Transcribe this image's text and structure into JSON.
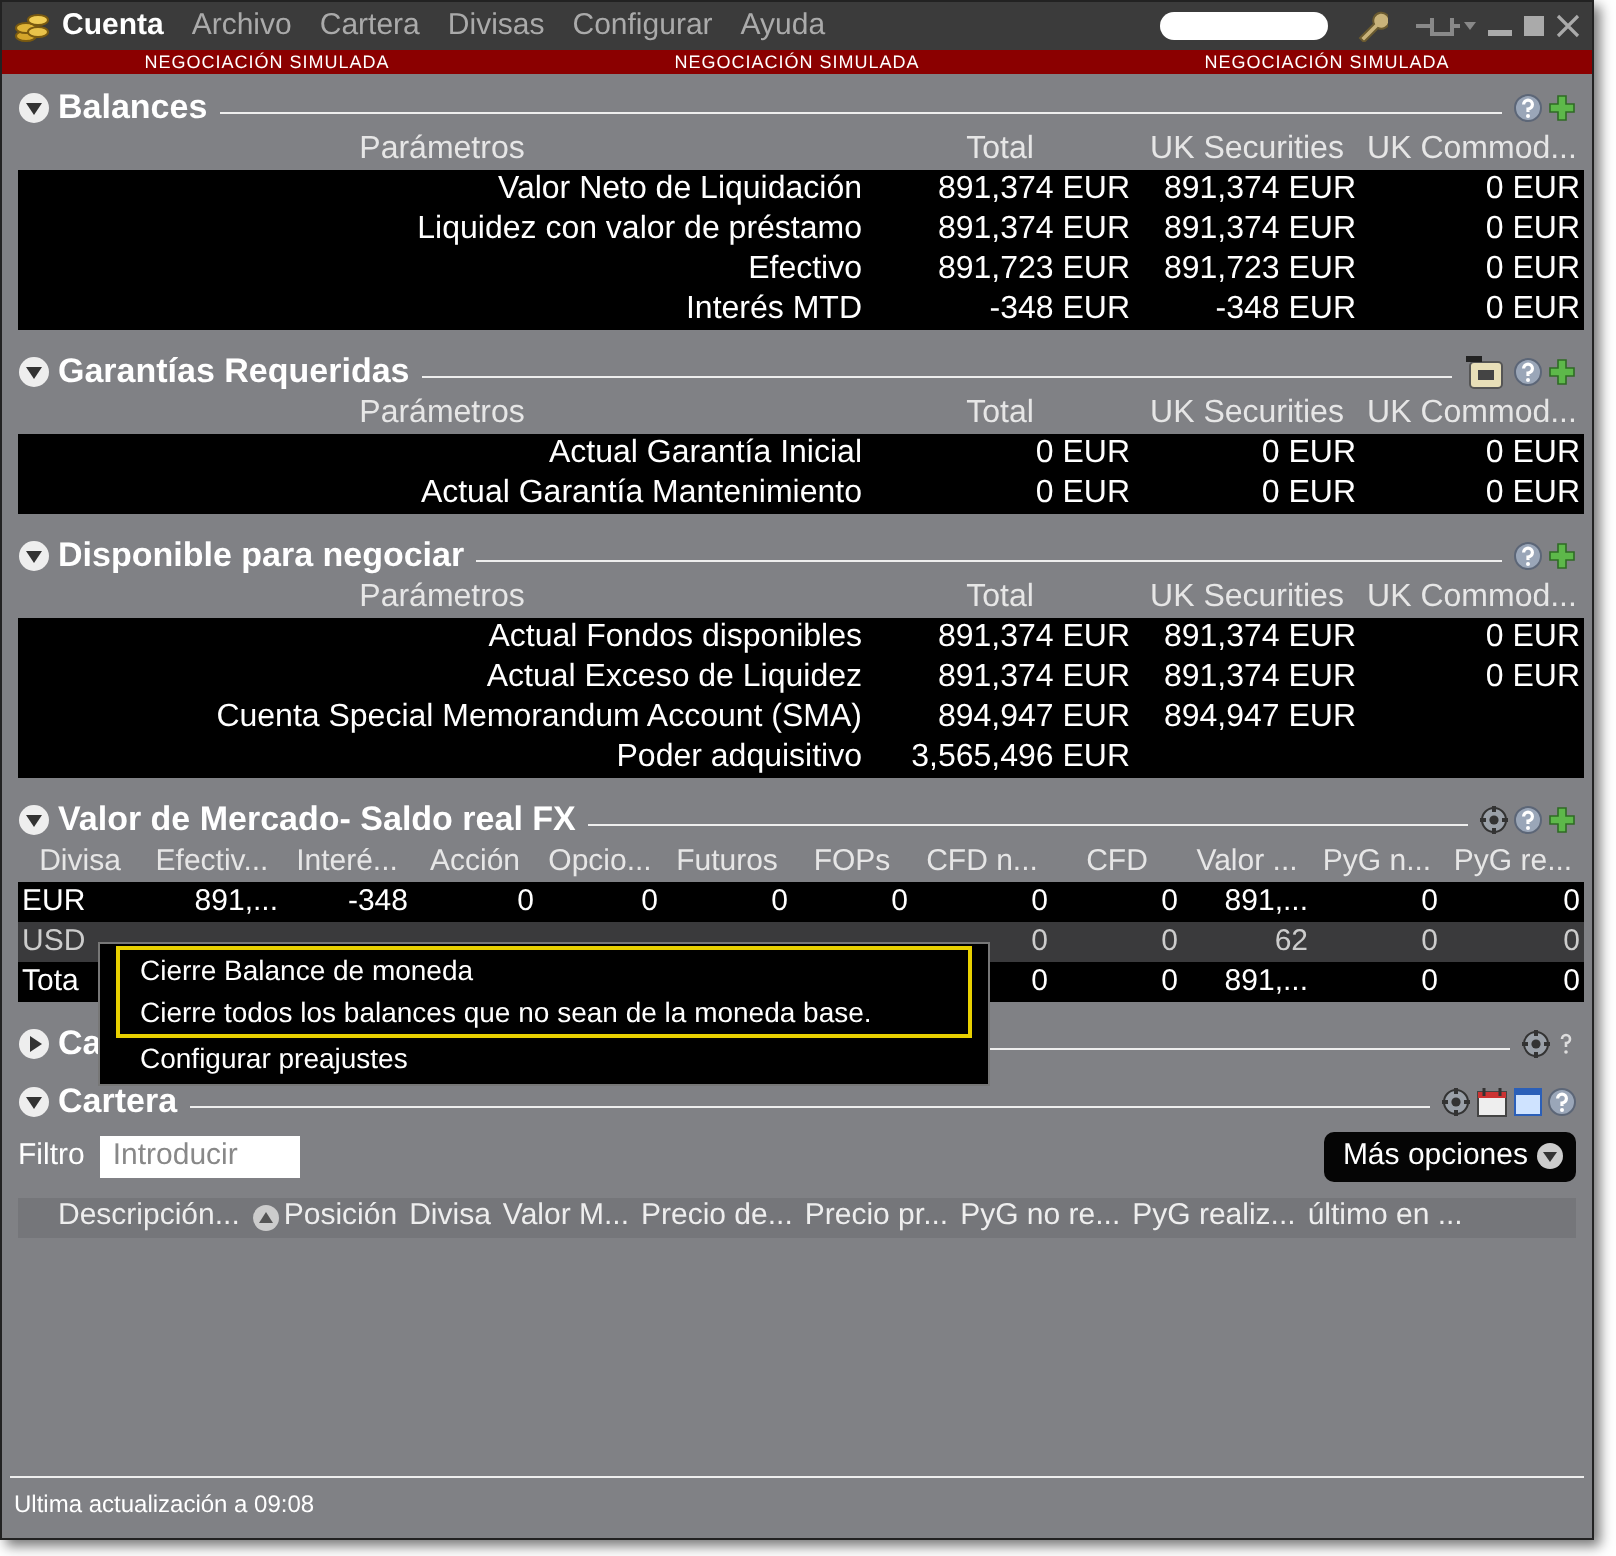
{
  "window": {
    "title": "Cuenta",
    "menu": [
      "Archivo",
      "Cartera",
      "Divisas",
      "Configurar",
      "Ayuda"
    ],
    "banner": [
      "NEGOCIACIÓN SIMULADA",
      "NEGOCIACIÓN SIMULADA",
      "NEGOCIACIÓN SIMULADA"
    ]
  },
  "sections": [
    {
      "kind": "grid",
      "title": "Balances",
      "expanded": true,
      "columns": [
        "Parámetros",
        "Total",
        "UK Securities",
        "UK Commod..."
      ],
      "rows": [
        [
          "Valor Neto de Liquidación",
          "891,374 EUR",
          "891,374 EUR",
          "0 EUR"
        ],
        [
          "Liquidez con valor de préstamo",
          "891,374 EUR",
          "891,374 EUR",
          "0 EUR"
        ],
        [
          "Efectivo",
          "891,723 EUR",
          "891,723 EUR",
          "0 EUR"
        ],
        [
          "Interés MTD",
          "-348 EUR",
          "-348 EUR",
          "0 EUR"
        ]
      ]
    },
    {
      "kind": "grid",
      "title": "Garantías Requeridas",
      "expanded": true,
      "columns": [
        "Parámetros",
        "Total",
        "UK Securities",
        "UK Commod..."
      ],
      "rows": [
        [
          "Actual Garantía Inicial",
          "0 EUR",
          "0 EUR",
          "0 EUR"
        ],
        [
          "Actual Garantía Mantenimiento",
          "0 EUR",
          "0 EUR",
          "0 EUR"
        ]
      ]
    },
    {
      "kind": "grid",
      "title": "Disponible para negociar",
      "expanded": true,
      "columns": [
        "Parámetros",
        "Total",
        "UK Securities",
        "UK Commod..."
      ],
      "rows": [
        [
          "Actual Fondos disponibles",
          "891,374 EUR",
          "891,374 EUR",
          "0 EUR"
        ],
        [
          "Actual Exceso de Liquidez",
          "891,374 EUR",
          "891,374 EUR",
          "0 EUR"
        ],
        [
          "Cuenta Special Memorandum Account (SMA)",
          "894,947 EUR",
          "894,947 EUR",
          null
        ],
        [
          "Poder adquisitivo",
          "3,565,496 EUR",
          null,
          null
        ]
      ]
    },
    {
      "kind": "currency",
      "title": "Valor de Mercado- Saldo real FX",
      "expanded": true,
      "columns": [
        "Divisa",
        "Efectiv...",
        "Interé...",
        "Acción",
        "Opcio...",
        "Futuros",
        "FOPs",
        "CFD n...",
        "CFD",
        "Valor ...",
        "PyG n...",
        "PyG re..."
      ],
      "rows": [
        {
          "selected": false,
          "cells": [
            "EUR",
            "891,...",
            "-348",
            "0",
            "0",
            "0",
            "0",
            "0",
            "0",
            "891,...",
            "0",
            "0"
          ]
        },
        {
          "selected": true,
          "cells": [
            "USD",
            null,
            null,
            null,
            null,
            null,
            null,
            "0",
            "0",
            "62",
            "0",
            "0"
          ]
        },
        {
          "selected": false,
          "cells": [
            "Tota",
            null,
            null,
            null,
            null,
            null,
            null,
            "0",
            "0",
            "891,...",
            "0",
            "0"
          ]
        }
      ]
    },
    {
      "kind": "collapsed",
      "title": "Ca",
      "expanded": false
    },
    {
      "kind": "portfolio",
      "title": "Cartera",
      "expanded": true,
      "filter": {
        "label": "Filtro",
        "placeholder": "Introducir"
      },
      "more_button": "Más opciones",
      "columns": [
        {
          "label": "Descripción...",
          "sorted": false
        },
        {
          "label": "Posición",
          "sorted": true
        },
        {
          "label": "Divisa",
          "sorted": false
        },
        {
          "label": "Valor M...",
          "sorted": false
        },
        {
          "label": "Precio de...",
          "sorted": false
        },
        {
          "label": "Precio pr...",
          "sorted": false
        },
        {
          "label": "PyG no re...",
          "sorted": false
        },
        {
          "label": "PyG realiz...",
          "sorted": false
        },
        {
          "label": "último en ...",
          "sorted": false
        }
      ]
    }
  ],
  "context_menu": {
    "items": [
      {
        "label": "Cierre Balance de moneda",
        "highlighted": true
      },
      {
        "label": "Cierre todos los balances que no sean de la moneda base.",
        "highlighted": true
      },
      {
        "label": "Configurar preajustes",
        "highlighted": false
      }
    ]
  },
  "status_bar": "Ultima actualización a 09:08"
}
